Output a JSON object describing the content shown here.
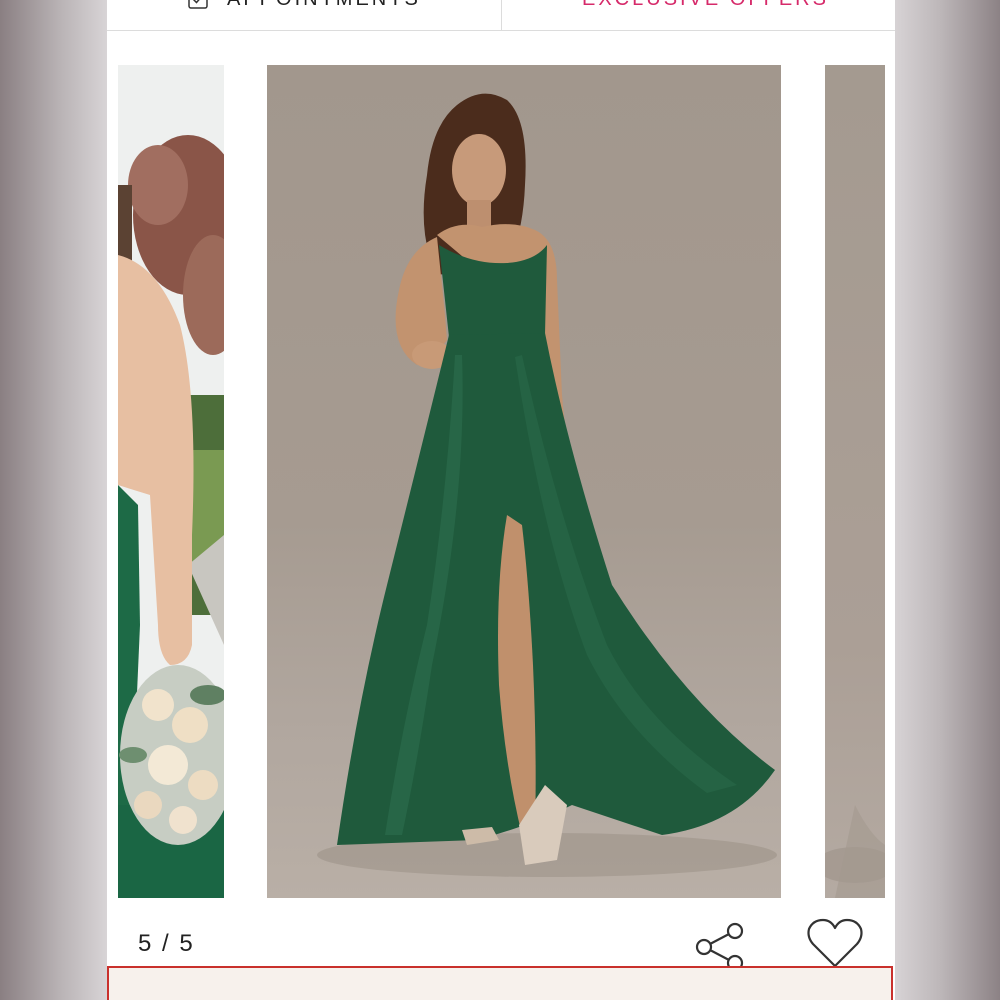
{
  "header": {
    "appointments_label": "APPOINTMENTS",
    "offers_label": "EXCLUSIVE OFFERS",
    "offers_color": "#d62a6a"
  },
  "carousel": {
    "current": 5,
    "total": 5,
    "counter_text": "5 / 5",
    "dress_color": "#1f5a3c"
  },
  "actions": {
    "share_icon": "share-icon",
    "favorite_icon": "heart-icon"
  },
  "bottom_panel": {
    "border_color": "#c9302c"
  }
}
